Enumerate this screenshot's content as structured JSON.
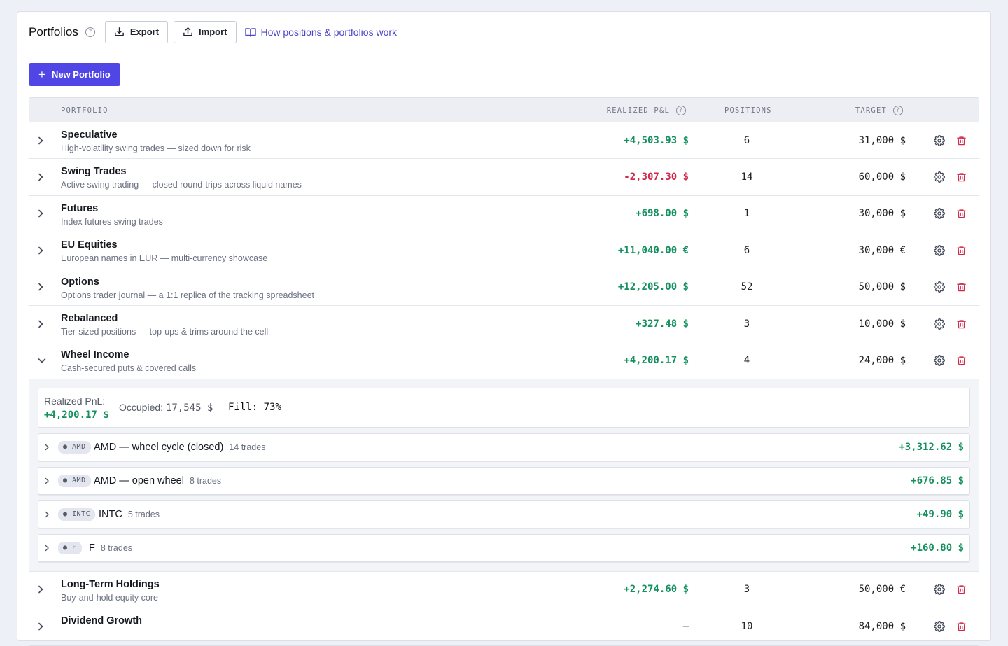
{
  "header": {
    "title": "Portfolios",
    "export_label": "Export",
    "import_label": "Import",
    "docs_link": "How positions & portfolios work",
    "help_glyph": "?"
  },
  "new_portfolio_label": "New Portfolio",
  "table": {
    "columns": {
      "portfolio": "PORTFOLIO",
      "realized_pnl": "REALIZED P&L",
      "positions": "POSITIONS",
      "target": "TARGET"
    },
    "rows": [
      {
        "name": "Speculative",
        "description": "High-volatility swing trades — sized down for risk",
        "pnl": "+4,503.93 $",
        "positions": "6",
        "target": "31,000 $"
      },
      {
        "name": "Swing Trades",
        "description": "Active swing trading — closed round-trips across liquid names",
        "pnl": "-2,307.30 $",
        "positions": "14",
        "target": "60,000 $"
      },
      {
        "name": "Futures",
        "description": "Index futures swing trades",
        "pnl": "+698.00 $",
        "positions": "1",
        "target": "30,000 $"
      },
      {
        "name": "EU Equities",
        "description": "European names in EUR — multi-currency showcase",
        "pnl": "+11,040.00 €",
        "positions": "6",
        "target": "30,000 €"
      },
      {
        "name": "Options",
        "description": "Options trader journal — a 1:1 replica of the tracking spreadsheet",
        "pnl": "+12,205.00 $",
        "positions": "52",
        "target": "50,000 $"
      },
      {
        "name": "Rebalanced",
        "description": "Tier-sized positions — top-ups & trims around the cell",
        "pnl": "+327.48 $",
        "positions": "3",
        "target": "10,000 $"
      },
      {
        "name": "Wheel Income",
        "description": "Cash-secured puts & covered calls",
        "pnl": "+4,200.17 $",
        "positions": "4",
        "target": "24,000 $"
      },
      {
        "name": "Long-Term Holdings",
        "description": "Buy-and-hold equity core",
        "pnl": "+2,274.60 $",
        "positions": "3",
        "target": "50,000 €"
      },
      {
        "name": "Dividend Growth",
        "description": "",
        "pnl": "—",
        "positions": "10",
        "target": "84,000 $"
      }
    ]
  },
  "expanded": {
    "realized_label": "Realized PnL:",
    "realized_value": "+4,200.17 $",
    "occupied_label": "Occupied:",
    "occupied_value": "17,545 $",
    "fill_text": "Fill: 73%",
    "positions": [
      {
        "ticker": "● AMD",
        "name": "AMD — wheel cycle (closed)",
        "trades": "14 trades",
        "pnl": "+3,312.62 $"
      },
      {
        "ticker": "● AMD",
        "name": "AMD — open wheel",
        "trades": "8 trades",
        "pnl": "+676.85 $"
      },
      {
        "ticker": "● INTC",
        "name": "INTC",
        "trades": "5 trades",
        "pnl": "+49.90 $"
      },
      {
        "ticker": "● F",
        "name": "F",
        "trades": "8 trades",
        "pnl": "+160.80 $"
      }
    ]
  },
  "colors": {
    "accent": "#4f46e5",
    "positive": "#14915f",
    "negative": "#d0284a",
    "danger_icon": "#d0284a"
  }
}
